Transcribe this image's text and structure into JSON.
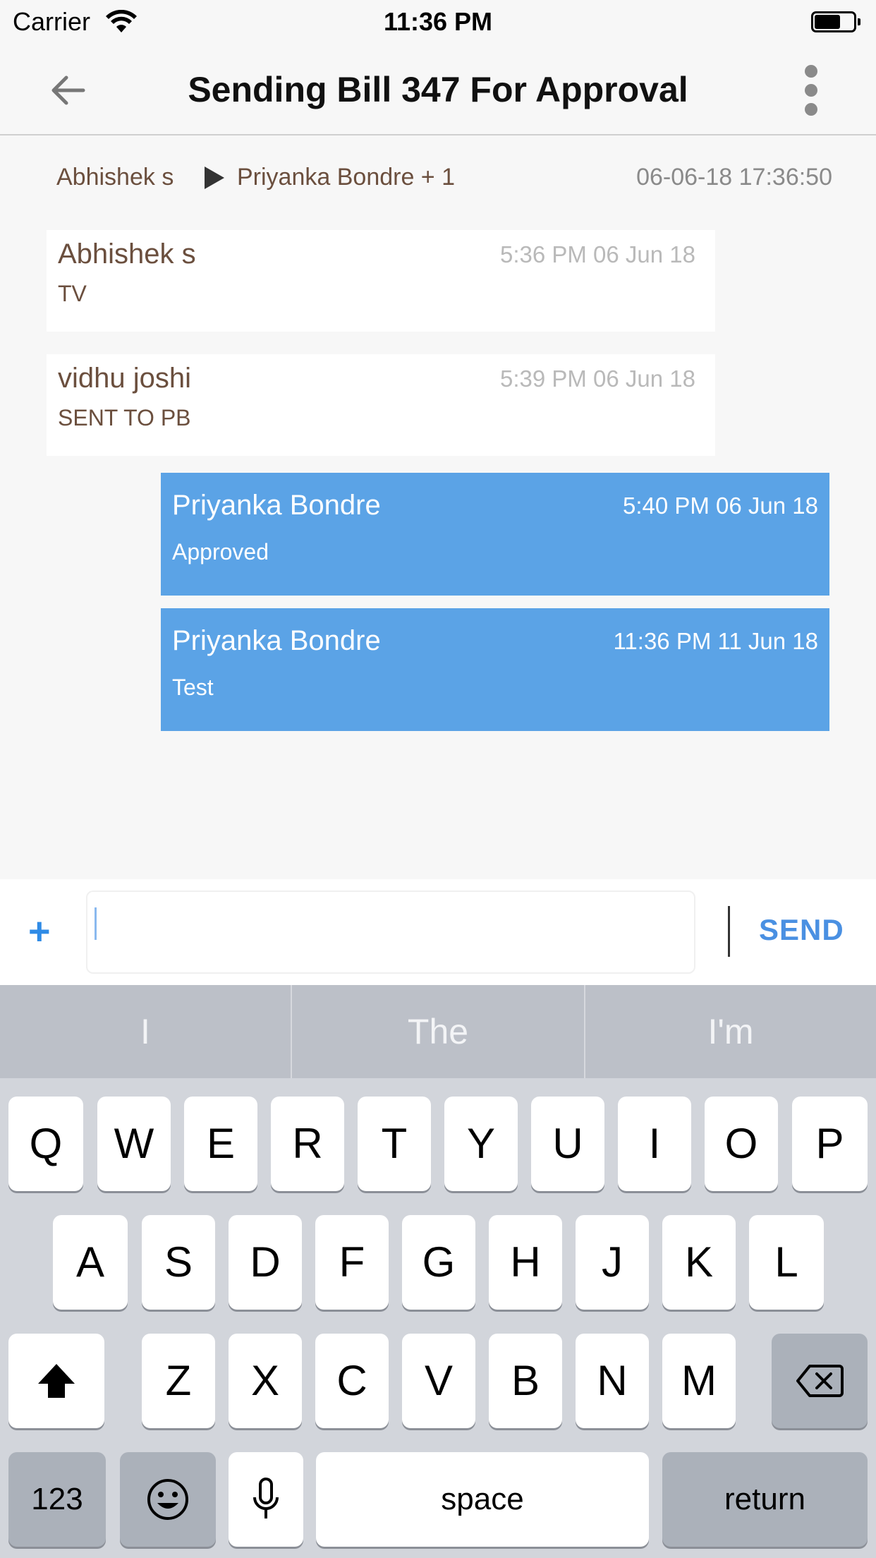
{
  "status_bar": {
    "carrier": "Carrier",
    "time": "11:36 PM",
    "icons": [
      "wifi-icon",
      "battery-icon"
    ]
  },
  "nav": {
    "title": "Sending Bill 347 For Approval",
    "icons": [
      "arrow-left-icon",
      "more-vertical-icon"
    ]
  },
  "thread": {
    "from": "Abhishek s",
    "to": "Priyanka Bondre + 1",
    "date": "06-06-18 17:36:50",
    "icon": "play-arrow-icon"
  },
  "messages": [
    {
      "sender": "Abhishek s",
      "time": "5:36 PM 06 Jun 18",
      "text": "TV",
      "direction": "incoming"
    },
    {
      "sender": "vidhu joshi",
      "time": "5:39 PM 06 Jun 18",
      "text": "SENT TO PB",
      "direction": "incoming"
    },
    {
      "sender": "Priyanka Bondre",
      "time": "5:40 PM 06 Jun 18",
      "text": "Approved",
      "direction": "outgoing"
    },
    {
      "sender": "Priyanka Bondre",
      "time": "11:36 PM 11 Jun 18",
      "text": "Test",
      "direction": "outgoing"
    }
  ],
  "composer": {
    "attach_label": "+",
    "input_value": "",
    "input_placeholder": "",
    "send_label": "SEND"
  },
  "keyboard": {
    "suggestions": [
      "I",
      "The",
      "I'm"
    ],
    "row1": [
      "Q",
      "W",
      "E",
      "R",
      "T",
      "Y",
      "U",
      "I",
      "O",
      "P"
    ],
    "row2": [
      "A",
      "S",
      "D",
      "F",
      "G",
      "H",
      "J",
      "K",
      "L"
    ],
    "row3": [
      "Z",
      "X",
      "C",
      "V",
      "B",
      "N",
      "M"
    ],
    "numbers_label": "123",
    "space_label": "space",
    "return_label": "return",
    "icons": [
      "shift-icon",
      "delete-icon",
      "emoji-icon",
      "microphone-icon"
    ]
  },
  "colors": {
    "accent": "#5ba3e6",
    "send": "#4a90e2",
    "sender_text": "#6b4f3e",
    "background": "#f7f7f7"
  }
}
